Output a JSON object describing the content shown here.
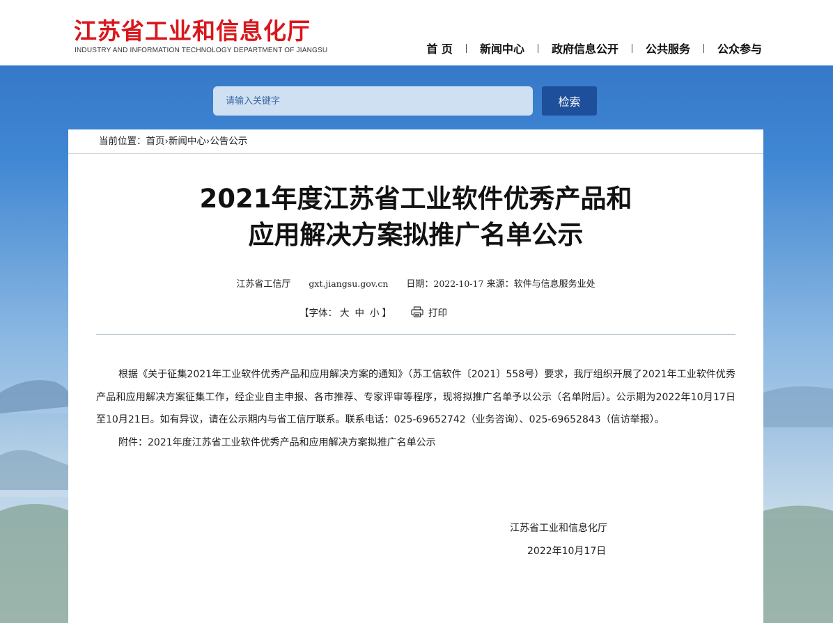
{
  "header": {
    "logo_cn": "江苏省工业和信息化厅",
    "logo_en": "INDUSTRY AND INFORMATION TECHNOLOGY DEPARTMENT OF JIANGSU",
    "nav": [
      "首 页",
      "新闻中心",
      "政府信息公开",
      "公共服务",
      "公众参与"
    ]
  },
  "search": {
    "placeholder": "请输入关键字",
    "button_label": "检索"
  },
  "breadcrumb": {
    "prefix": "当前位置：",
    "items": [
      "首页",
      "新闻中心",
      "公告公示"
    ],
    "separator": "›"
  },
  "article": {
    "title_line1": "2021年度江苏省工业软件优秀产品和",
    "title_line2": "应用解决方案拟推广名单公示",
    "meta": {
      "site_name": "江苏省工信厅",
      "site_url": "gxt.jiangsu.gov.cn",
      "date_label": "日期：",
      "date": "2022-10-17",
      "source_label": "来源：",
      "source": "软件与信息服务业处"
    },
    "tools": {
      "font_label_open": "【字体：",
      "font_large": "大",
      "font_medium": "中",
      "font_small": "小",
      "font_label_close": "】",
      "print_label": "打印"
    },
    "paragraph1": "根据《关于征集2021年工业软件优秀产品和应用解决方案的通知》（苏工信软件〔2021〕558号）要求，我厅组织开展了2021年工业软件优秀产品和应用解决方案征集工作，经企业自主申报、各市推荐、专家评审等程序，现将拟推广名单予以公示（名单附后）。公示期为2022年10月17日至10月21日。如有异议，请在公示期内与省工信厅联系。联系电话：025-69652742（业务咨询）、025-69652843（信访举报）。",
    "attachment_label": "附件：",
    "attachment_title": "2021年度江苏省工业软件优秀产品和应用解决方案拟推广名单公示",
    "signature_org": "江苏省工业和信息化厅",
    "signature_date": "2022年10月17日"
  },
  "colors": {
    "logo_red": "#d8171c",
    "search_button": "#1e4f9a",
    "search_field": "#cfe0f3"
  }
}
